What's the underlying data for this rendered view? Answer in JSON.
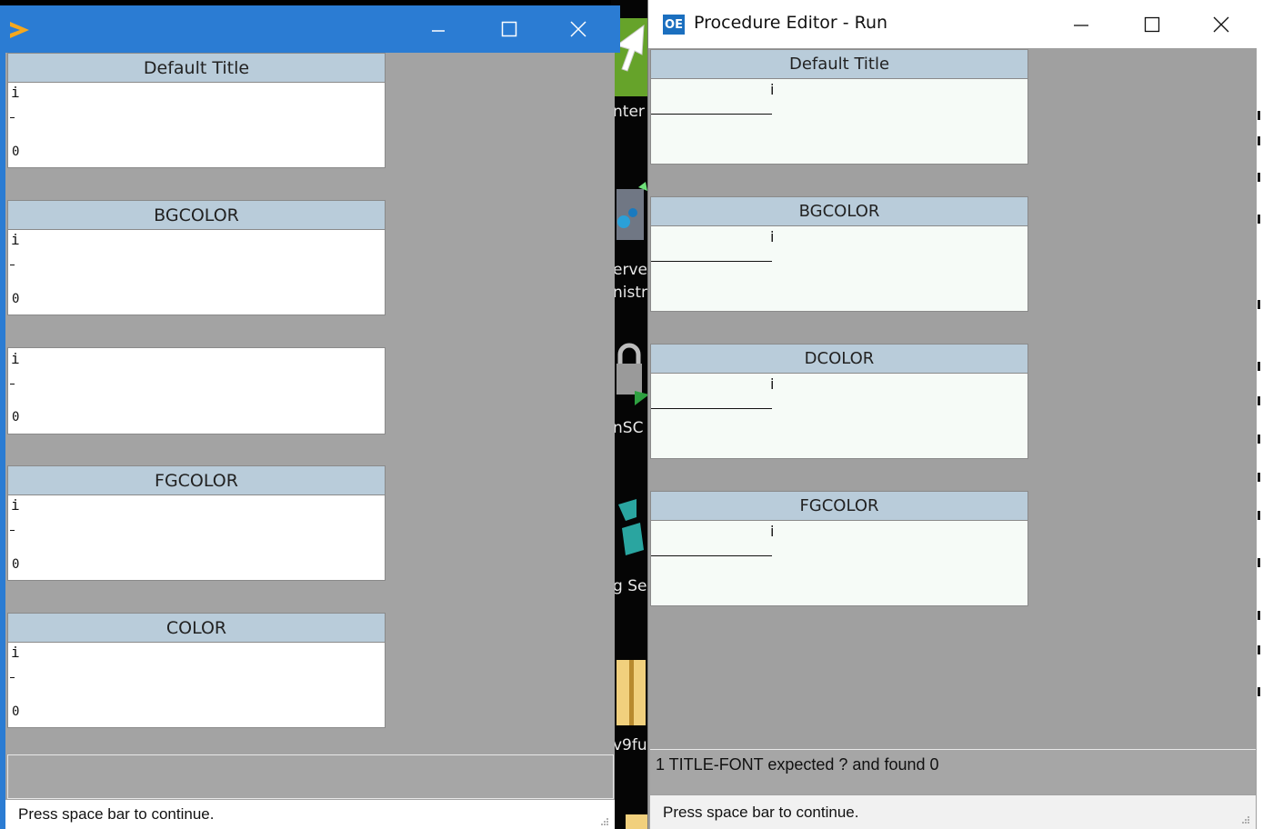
{
  "desktop": {
    "labels": [
      "nter",
      "erver",
      "nistr",
      "nSC",
      "g Se",
      "v9fu"
    ]
  },
  "window1": {
    "title": "",
    "frames": [
      {
        "title": "Default Title",
        "char": "i",
        "zero": "0"
      },
      {
        "title": "BGCOLOR",
        "char": "i",
        "zero": "0"
      },
      {
        "title": "",
        "char": "i",
        "zero": "0"
      },
      {
        "title": "FGCOLOR",
        "char": "i",
        "zero": "0"
      },
      {
        "title": "COLOR",
        "char": "i",
        "zero": "0"
      }
    ],
    "status": "Press space bar to continue."
  },
  "window2": {
    "icon_text": "OE",
    "title": "Procedure Editor - Run",
    "frames": [
      {
        "title": "Default Title",
        "char": "i"
      },
      {
        "title": "BGCOLOR",
        "char": "i"
      },
      {
        "title": "DCOLOR",
        "char": "i"
      },
      {
        "title": "FGCOLOR",
        "char": "i"
      }
    ],
    "message": "1 TITLE-FONT expected ? and found 0",
    "status": "Press space bar to continue."
  },
  "colors": {
    "titlebar_blue": "#2b7cd3",
    "frame_title_bg": "#b9ccda",
    "window_bg_gray": "#a3a3a3",
    "frame_bg_mint": "#f6fbf7"
  }
}
